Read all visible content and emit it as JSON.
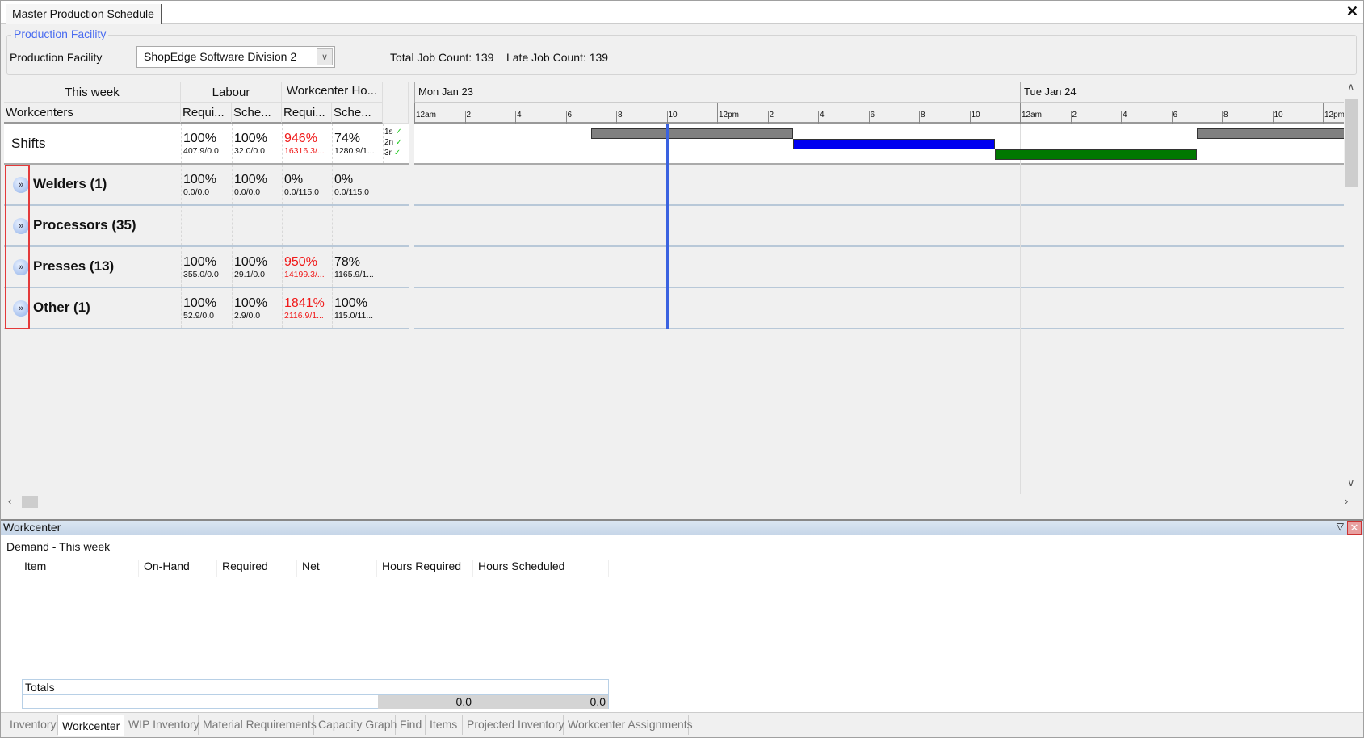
{
  "window": {
    "title": "Master Production Schedule",
    "close_icon": "close-icon"
  },
  "facility": {
    "group_title": "Production Facility",
    "label": "Production Facility",
    "selected": "ShopEdge Software Division 2",
    "total_job_count": "Total Job Count: 139",
    "late_job_count": "Late Job Count: 139"
  },
  "grid": {
    "header": {
      "this_week": "This week",
      "labour": "Labour",
      "workcenter_hours": "Workcenter Ho...",
      "workcenters": "Workcenters",
      "labour_req": "Requi...",
      "labour_sch": "Sche...",
      "wc_req": "Requi...",
      "wc_sch": "Sche..."
    },
    "shifts": {
      "name": "Shifts",
      "cells": [
        {
          "pct": "100%",
          "sub": "407.9/0.0",
          "red": false
        },
        {
          "pct": "100%",
          "sub": "32.0/0.0",
          "red": false
        },
        {
          "pct": "946%",
          "sub": "16316.3/...",
          "red": true
        },
        {
          "pct": "74%",
          "sub": "1280.9/1...",
          "red": false
        }
      ],
      "shift_labels": [
        "1s",
        "2n",
        "3r"
      ]
    },
    "rows": [
      {
        "name": "Welders (1)",
        "cells": [
          {
            "pct": "100%",
            "sub": "0.0/0.0",
            "red": false
          },
          {
            "pct": "100%",
            "sub": "0.0/0.0",
            "red": false
          },
          {
            "pct": "0%",
            "sub": "0.0/115.0",
            "red": false
          },
          {
            "pct": "0%",
            "sub": "0.0/115.0",
            "red": false
          }
        ]
      },
      {
        "name": "Processors (35)",
        "cells": []
      },
      {
        "name": "Presses (13)",
        "cells": [
          {
            "pct": "100%",
            "sub": "355.0/0.0",
            "red": false
          },
          {
            "pct": "100%",
            "sub": "29.1/0.0",
            "red": false
          },
          {
            "pct": "950%",
            "sub": "14199.3/...",
            "red": true
          },
          {
            "pct": "78%",
            "sub": "1165.9/1...",
            "red": false
          }
        ]
      },
      {
        "name": "Other (1)",
        "cells": [
          {
            "pct": "100%",
            "sub": "52.9/0.0",
            "red": false
          },
          {
            "pct": "100%",
            "sub": "2.9/0.0",
            "red": false
          },
          {
            "pct": "1841%",
            "sub": "2116.9/1...",
            "red": true
          },
          {
            "pct": "100%",
            "sub": "115.0/11...",
            "red": false
          }
        ]
      }
    ]
  },
  "gantt": {
    "days": [
      "Mon Jan 23",
      "Tue Jan 24"
    ],
    "tick_labels": [
      "12am",
      "2",
      "4",
      "6",
      "8",
      "10",
      "12pm",
      "2",
      "4",
      "6",
      "8",
      "10"
    ],
    "current_time": "Mon 10:00",
    "shift_bars": [
      {
        "shift": "1s",
        "start": "Mon 07:00",
        "end": "Mon 15:00",
        "color": "#808080"
      },
      {
        "shift": "2n",
        "start": "Mon 15:00",
        "end": "Mon 23:00",
        "color": "#0000f0"
      },
      {
        "shift": "3r",
        "start": "Mon 23:00",
        "end": "Tue 07:00",
        "color": "#007800"
      },
      {
        "shift": "1s",
        "start": "Tue 07:00",
        "end": "Tue 15:00",
        "color": "#808080"
      }
    ]
  },
  "panel": {
    "title": "Workcenter",
    "subtitle": "Demand - This week",
    "columns": [
      "Item",
      "On-Hand",
      "Required",
      "Net",
      "Hours Required",
      "Hours Scheduled"
    ],
    "totals_label": "Totals",
    "totals": [
      "0.0",
      "0.0"
    ]
  },
  "bottom_tabs": [
    {
      "label": "Inventory",
      "active": false
    },
    {
      "label": "Workcenter",
      "active": true
    },
    {
      "label": "WIP Inventory",
      "active": false
    },
    {
      "label": "Material Requirements",
      "active": false
    },
    {
      "label": "Capacity Graph",
      "active": false
    },
    {
      "label": "Find",
      "active": false
    },
    {
      "label": "Items",
      "active": false
    },
    {
      "label": "Projected Inventory",
      "active": false
    },
    {
      "label": "Workcenter Assignments",
      "active": false
    }
  ]
}
